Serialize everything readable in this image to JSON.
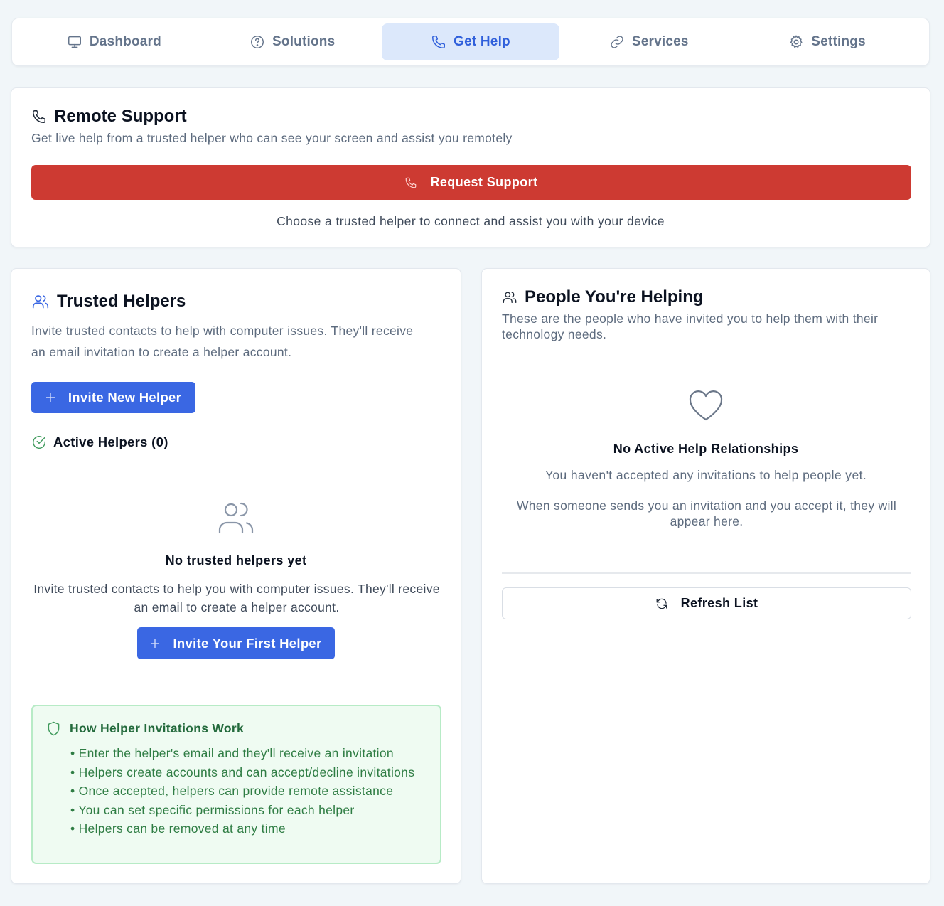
{
  "nav": {
    "tabs": [
      {
        "label": "Dashboard",
        "icon": "monitor-icon",
        "active": false
      },
      {
        "label": "Solutions",
        "icon": "help-circle-icon",
        "active": false
      },
      {
        "label": "Get Help",
        "icon": "phone-icon",
        "active": true
      },
      {
        "label": "Services",
        "icon": "link-icon",
        "active": false
      },
      {
        "label": "Settings",
        "icon": "gear-icon",
        "active": false
      }
    ]
  },
  "remote_support": {
    "title": "Remote Support",
    "subtitle": "Get live help from a trusted helper who can see your screen and assist you remotely",
    "button_label": "Request Support",
    "note": "Choose a trusted helper to connect and assist you with your device"
  },
  "trusted_helpers": {
    "title": "Trusted Helpers",
    "description": "Invite trusted contacts to help with computer issues. They'll receive an email invitation to create a helper account.",
    "invite_button": "Invite New Helper",
    "active_label": "Active Helpers (0)",
    "empty_title": "No trusted helpers yet",
    "empty_description": "Invite trusted contacts to help you with computer issues. They'll receive an email to create a helper account.",
    "invite_first_button": "Invite Your First Helper",
    "how": {
      "title": "How Helper Invitations Work",
      "items": [
        "Enter the helper's email and they'll receive an invitation",
        "Helpers create accounts and can accept/decline invitations",
        "Once accepted, helpers can provide remote assistance",
        "You can set specific permissions for each helper",
        "Helpers can be removed at any time"
      ]
    }
  },
  "helping": {
    "title": "People You're Helping",
    "description": "These are the people who have invited you to help them with their technology needs.",
    "empty_title": "No Active Help Relationships",
    "empty_subtitle": "You haven't accepted any invitations to help people yet.",
    "empty_description": "When someone sends you an invitation and you accept it, they will appear here.",
    "refresh_button": "Refresh List"
  },
  "colors": {
    "accent": "#3a67e3",
    "danger": "#cd3a32",
    "active_tab_bg": "#dce8fb",
    "info_green": "#2f7d44"
  }
}
